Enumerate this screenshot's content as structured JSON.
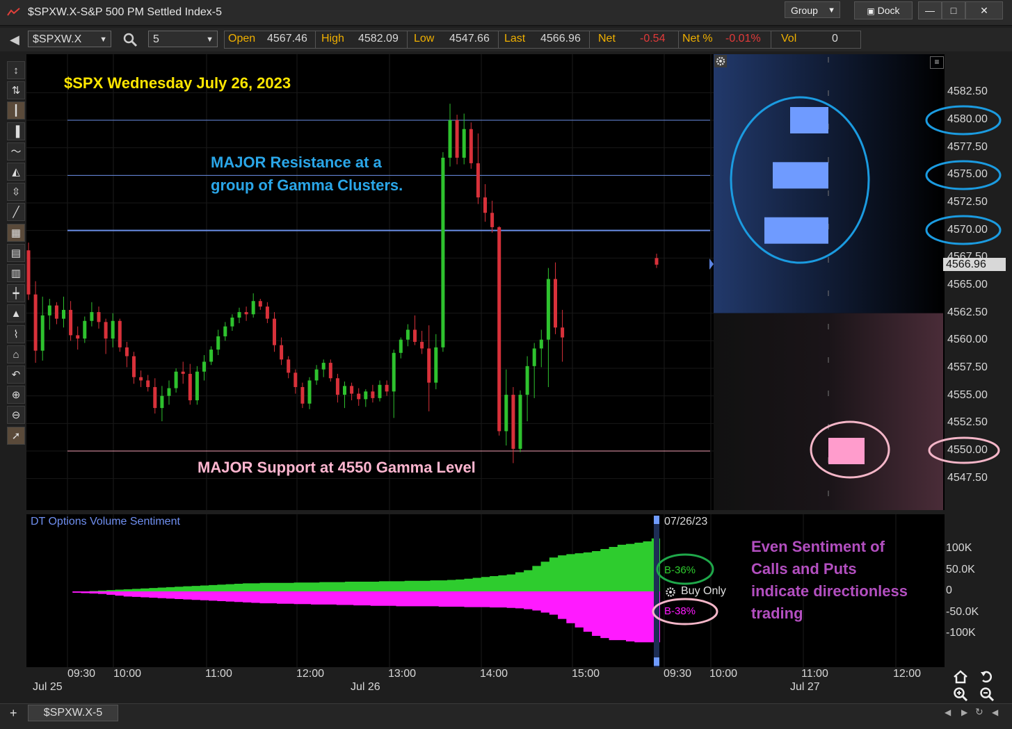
{
  "window": {
    "title": "$SPXW.X-S&P 500 PM Settled Index-5",
    "group_label": "Group",
    "dock_label": "Dock",
    "min_label": "—",
    "max_label": "□",
    "close_label": "✕"
  },
  "toolbar": {
    "symbol": "$SPXW.X",
    "interval": "5",
    "quote": {
      "open_label": "Open",
      "open": "4567.46",
      "high_label": "High",
      "high": "4582.09",
      "low_label": "Low",
      "low": "4547.66",
      "last_label": "Last",
      "last": "4566.96",
      "net_label": "Net",
      "net": "-0.54",
      "netpct_label": "Net %",
      "netpct": "-0.01%",
      "vol_label": "Vol",
      "vol": "0"
    }
  },
  "tools": [
    "cursor-cross-icon",
    "cursor-bars-icon",
    "candlestick-icon",
    "bar-chart-icon",
    "line-chart-icon",
    "area-chart-icon",
    "ruler-icon",
    "trendline-icon",
    "grid-icon",
    "table-icon",
    "table-small-icon",
    "horizontal-line-icon",
    "bull-icon",
    "fib-icon",
    "home-icon",
    "undo-icon",
    "zoom-in-icon",
    "zoom-out-icon",
    "pointer-icon"
  ],
  "annotations": {
    "title": "$SPX Wednesday July 26, 2023",
    "resistance_line1": "MAJOR Resistance at a",
    "resistance_line2": "group of Gamma Clusters.",
    "support": "MAJOR Support at 4550 Gamma Level",
    "sentiment_line1": "Even Sentiment of",
    "sentiment_line2": "Calls and Puts",
    "sentiment_line3": "indicate directionless",
    "sentiment_line4": "trading"
  },
  "indicator": {
    "name": "DT Options Volume Sentiment",
    "date": "07/26/23",
    "buy_only": "Buy Only",
    "call_pct": "B-36%",
    "put_pct": "B-38%"
  },
  "last_price_tag": "4566.96",
  "colors": {
    "up": "#2ec22e",
    "down": "#d8313a",
    "resistance": "#6b8fe8",
    "support": "#f2a0b4",
    "call_fill": "#2ecc2e",
    "put_fill": "#ff1aff",
    "gamma_up": "#6f9bff",
    "gamma_down": "#ff9ccc",
    "annot_yellow": "#ffe600",
    "annot_blue": "#2aa6e8",
    "annot_pink": "#ffb6d0",
    "annot_purple": "#b34fc0"
  },
  "chart_data": [
    {
      "type": "candlestick",
      "title": "$SPX Wednesday July 26, 2023",
      "y_ticks": [
        "4582.50",
        "4580.00",
        "4577.50",
        "4575.00",
        "4572.50",
        "4570.00",
        "4567.50",
        "4565.00",
        "4562.50",
        "4560.00",
        "4557.50",
        "4555.00",
        "4552.50",
        "4550.00",
        "4547.50"
      ],
      "ylim": [
        4546.5,
        4584.3
      ],
      "x_ticks": [
        "09:30",
        "10:00",
        "11:00",
        "12:00",
        "13:00",
        "14:00",
        "15:00",
        "09:30",
        "10:00",
        "11:00",
        "12:00"
      ],
      "date_labels": [
        "Jul 25",
        "Jul 26",
        "Jul 27"
      ],
      "levels": [
        {
          "price": 4580,
          "kind": "resistance"
        },
        {
          "price": 4575,
          "kind": "resistance"
        },
        {
          "price": 4570,
          "kind": "resistance"
        },
        {
          "price": 4550,
          "kind": "support"
        }
      ],
      "gamma_bars": [
        {
          "price": 4580,
          "size": 0.55,
          "side": "up"
        },
        {
          "price": 4575,
          "size": 0.8,
          "side": "up"
        },
        {
          "price": 4570,
          "size": 0.92,
          "side": "up"
        },
        {
          "price": 4550,
          "size": 0.52,
          "side": "down"
        }
      ],
      "candles": [
        [
          4568.2,
          4568.9,
          4563.7,
          4564.2
        ],
        [
          4564.2,
          4565.4,
          4558.0,
          4559.1
        ],
        [
          4559.1,
          4564.0,
          4558.2,
          4562.3
        ],
        [
          4562.3,
          4563.8,
          4561.0,
          4563.2
        ],
        [
          4563.2,
          4563.5,
          4561.5,
          4562.0
        ],
        [
          4562.0,
          4564.0,
          4561.2,
          4562.8
        ],
        [
          4562.8,
          4563.6,
          4560.0,
          4560.5
        ],
        [
          4560.5,
          4561.3,
          4559.2,
          4560.2
        ],
        [
          4560.2,
          4562.2,
          4559.8,
          4561.8
        ],
        [
          4561.8,
          4563.5,
          4561.3,
          4562.6
        ],
        [
          4562.6,
          4563.1,
          4561.1,
          4561.7
        ],
        [
          4561.7,
          4562.0,
          4558.8,
          4560.2
        ],
        [
          4560.2,
          4562.5,
          4559.4,
          4561.8
        ],
        [
          4561.8,
          4562.0,
          4559.0,
          4559.4
        ],
        [
          4559.4,
          4559.9,
          4557.6,
          4558.6
        ],
        [
          4558.6,
          4559.0,
          4556.1,
          4556.7
        ],
        [
          4556.7,
          4557.3,
          4555.8,
          4556.4
        ],
        [
          4556.4,
          4556.9,
          4555.4,
          4555.8
        ],
        [
          4555.8,
          4556.6,
          4553.4,
          4553.9
        ],
        [
          4553.9,
          4555.9,
          4552.7,
          4555.0
        ],
        [
          4555.0,
          4556.4,
          4554.2,
          4555.7
        ],
        [
          4555.7,
          4557.5,
          4555.3,
          4557.2
        ],
        [
          4557.2,
          4558.1,
          4556.1,
          4557.0
        ],
        [
          4557.0,
          4557.9,
          4554.2,
          4554.6
        ],
        [
          4554.6,
          4557.7,
          4554.2,
          4557.2
        ],
        [
          4557.2,
          4558.7,
          4556.4,
          4558.1
        ],
        [
          4558.1,
          4559.5,
          4557.8,
          4559.2
        ],
        [
          4559.2,
          4561.0,
          4558.7,
          4560.4
        ],
        [
          4560.4,
          4561.7,
          4560.0,
          4561.3
        ],
        [
          4561.3,
          4562.4,
          4560.9,
          4562.1
        ],
        [
          4562.1,
          4563.0,
          4561.6,
          4562.6
        ],
        [
          4562.6,
          4563.1,
          4561.8,
          4562.4
        ],
        [
          4562.4,
          4564.3,
          4562.1,
          4563.6
        ],
        [
          4563.6,
          4563.8,
          4562.8,
          4563.1
        ],
        [
          4563.1,
          4563.5,
          4561.6,
          4562.0
        ],
        [
          4562.0,
          4562.6,
          4559.0,
          4559.6
        ],
        [
          4559.6,
          4560.3,
          4557.8,
          4558.3
        ],
        [
          4558.3,
          4558.6,
          4556.6,
          4557.1
        ],
        [
          4557.1,
          4557.4,
          4555.2,
          4555.8
        ],
        [
          4555.8,
          4556.2,
          4553.9,
          4554.3
        ],
        [
          4554.3,
          4556.7,
          4553.8,
          4556.4
        ],
        [
          4556.4,
          4557.8,
          4556.0,
          4557.4
        ],
        [
          4557.4,
          4558.3,
          4556.7,
          4558.0
        ],
        [
          4558.0,
          4558.3,
          4556.3,
          4556.6
        ],
        [
          4556.6,
          4557.0,
          4554.4,
          4555.1
        ],
        [
          4555.1,
          4556.3,
          4553.9,
          4555.9
        ],
        [
          4555.9,
          4556.2,
          4554.6,
          4555.2
        ],
        [
          4555.2,
          4555.7,
          4554.1,
          4554.7
        ],
        [
          4554.7,
          4555.6,
          4554.0,
          4555.4
        ],
        [
          4555.4,
          4556.0,
          4554.4,
          4554.8
        ],
        [
          4554.8,
          4556.4,
          4554.5,
          4556.0
        ],
        [
          4556.0,
          4556.4,
          4555.0,
          4555.4
        ],
        [
          4555.4,
          4559.2,
          4553.0,
          4558.9
        ],
        [
          4558.9,
          4560.3,
          4558.4,
          4560.1
        ],
        [
          4560.1,
          4561.5,
          4559.5,
          4561.0
        ],
        [
          4561.0,
          4562.3,
          4559.6,
          4559.9
        ],
        [
          4559.9,
          4560.9,
          4558.8,
          4559.3
        ],
        [
          4559.3,
          4561.4,
          4553.6,
          4556.2
        ],
        [
          4556.2,
          4560.6,
          4555.6,
          4559.4
        ],
        [
          4559.4,
          4577.1,
          4559.0,
          4576.6
        ],
        [
          4576.6,
          4581.5,
          4575.8,
          4580.0
        ],
        [
          4580.0,
          4580.5,
          4576.0,
          4576.6
        ],
        [
          4576.6,
          4580.6,
          4576.0,
          4579.2
        ],
        [
          4579.2,
          4579.8,
          4575.6,
          4576.1
        ],
        [
          4576.1,
          4578.8,
          4572.4,
          4573.0
        ],
        [
          4573.0,
          4574.2,
          4570.8,
          4571.6
        ],
        [
          4571.6,
          4572.7,
          4569.8,
          4570.3
        ],
        [
          4570.3,
          4570.4,
          4551.4,
          4551.8
        ],
        [
          4551.8,
          4557.4,
          4550.5,
          4555.1
        ],
        [
          4555.1,
          4555.8,
          4548.9,
          4550.2
        ],
        [
          4550.2,
          4555.5,
          4549.9,
          4555.1
        ],
        [
          4555.1,
          4558.6,
          4552.7,
          4557.7
        ],
        [
          4557.7,
          4559.8,
          4554.8,
          4559.3
        ],
        [
          4559.3,
          4561.0,
          4557.6,
          4560.1
        ],
        [
          4560.1,
          4566.6,
          4555.8,
          4565.6
        ],
        [
          4565.6,
          4567.1,
          4560.6,
          4561.2
        ],
        [
          4561.2,
          4562.8,
          4558.1,
          4560.3
        ],
        [
          4567.5,
          4567.9,
          4566.6,
          4566.9
        ]
      ]
    },
    {
      "type": "area",
      "title": "DT Options Volume Sentiment",
      "y_ticks": [
        "100K",
        "50.0K",
        "0",
        "-50.0K",
        "-100K"
      ],
      "ylim": [
        -150000,
        150000
      ],
      "series": [
        {
          "name": "Calls",
          "values": [
            0,
            0,
            0,
            1000,
            2000,
            3000,
            4000,
            5000,
            6000,
            7000,
            8000,
            9000,
            10000,
            11000,
            12000,
            13000,
            14000,
            15000,
            16000,
            17000,
            18000,
            19000,
            19000,
            20000,
            20000,
            20000,
            20000,
            21000,
            21000,
            21000,
            22000,
            22000,
            22000,
            23000,
            23000,
            23000,
            23000,
            24000,
            24000,
            24000,
            25000,
            25000,
            25000,
            26000,
            26000,
            27000,
            28000,
            30000,
            32000,
            34000,
            36000,
            38000,
            40000,
            45000,
            50000,
            60000,
            70000,
            80000,
            85000,
            88000,
            90000,
            92000,
            95000,
            100000,
            105000,
            110000,
            112000,
            115000,
            118000,
            125000,
            140000
          ]
        },
        {
          "name": "Puts",
          "values": [
            0,
            -3000,
            -4000,
            -5000,
            -6000,
            -8000,
            -10000,
            -12000,
            -13000,
            -14000,
            -15000,
            -16000,
            -17000,
            -18000,
            -19000,
            -20000,
            -21000,
            -22000,
            -23000,
            -24000,
            -25000,
            -26000,
            -27000,
            -28000,
            -28000,
            -29000,
            -29000,
            -30000,
            -30000,
            -31000,
            -31000,
            -31000,
            -32000,
            -32000,
            -33000,
            -33000,
            -34000,
            -34000,
            -34000,
            -35000,
            -35000,
            -35000,
            -35000,
            -35000,
            -36000,
            -36000,
            -36000,
            -37000,
            -37000,
            -37000,
            -38000,
            -38000,
            -39000,
            -40000,
            -42000,
            -45000,
            -50000,
            -55000,
            -65000,
            -75000,
            -85000,
            -95000,
            -105000,
            -110000,
            -115000,
            -115000,
            -118000,
            -120000,
            -120000,
            -120000,
            -125000
          ]
        }
      ],
      "x_ticks": [
        "09:30",
        "10:00",
        "11:00",
        "12:00",
        "13:00",
        "14:00",
        "15:00",
        "09:30",
        "10:00",
        "11:00",
        "12:00"
      ]
    }
  ],
  "footer": {
    "tab_label": "$SPXW.X-5",
    "add_label": "+"
  }
}
